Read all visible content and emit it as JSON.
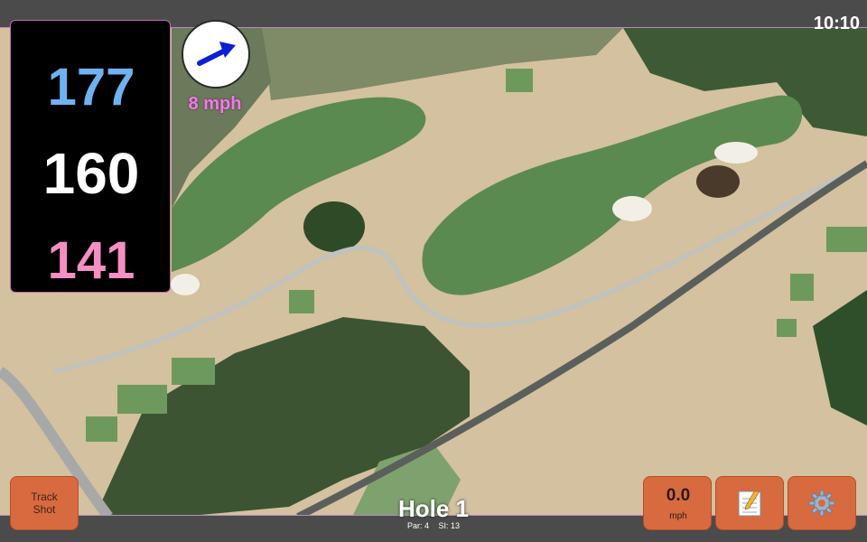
{
  "status_bar": {
    "time": "10:10"
  },
  "distances": {
    "back": "177",
    "center": "160",
    "front": "141"
  },
  "wind": {
    "speed": "8 mph",
    "icon": "wind-direction-arrow-icon"
  },
  "buttons": {
    "track_shot_line1": "Track",
    "track_shot_line2": "Shot",
    "speed_value": "0.0",
    "speed_unit": "mph",
    "notes_icon": "notepad-icon",
    "settings_icon": "gear-icon"
  },
  "hole": {
    "title": "Hole 1",
    "par": "Par: 4",
    "stroke_index": "SI: 13"
  },
  "colors": {
    "back_distance": "#6fb2f2",
    "center_distance": "#ffffff",
    "front_distance": "#f48fc3",
    "wind_speed": "#f07be6",
    "button_bg": "#d86a3f"
  }
}
